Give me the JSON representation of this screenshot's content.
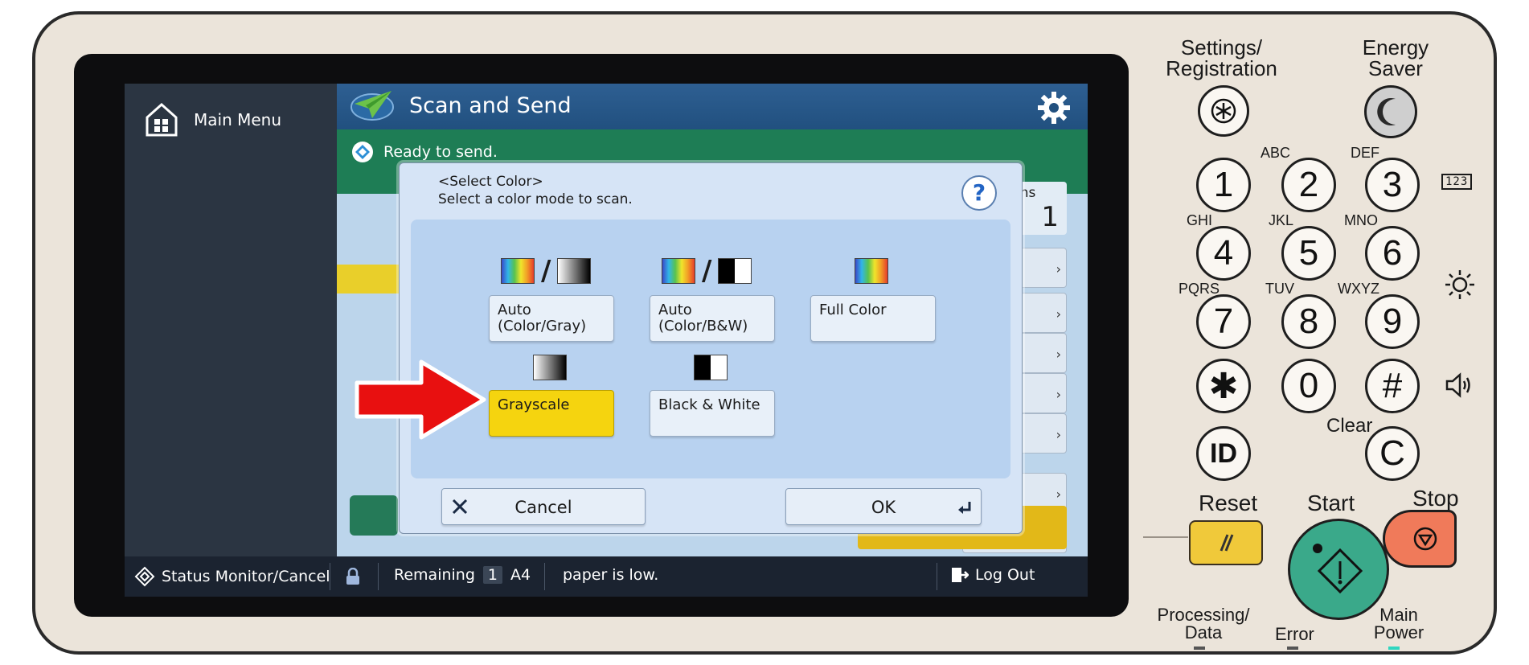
{
  "sidebar": {
    "main_menu_label": "Main Menu"
  },
  "app": {
    "title": "Scan and Send",
    "status": "Ready to send."
  },
  "destinations": {
    "label": "Destinations",
    "count": "1"
  },
  "dialog": {
    "title_line1": "<Select Color>",
    "title_line2": "Select a color mode to scan.",
    "options": [
      {
        "label_line1": "Auto",
        "label_line2": "(Color/Gray)"
      },
      {
        "label_line1": "Auto",
        "label_line2": "(Color/B&W)"
      },
      {
        "label_line1": "Full Color",
        "label_line2": ""
      },
      {
        "label_line1": "Grayscale",
        "label_line2": ""
      },
      {
        "label_line1": "Black & White",
        "label_line2": ""
      }
    ],
    "selected": "Grayscale",
    "cancel_label": "Cancel",
    "ok_label": "OK"
  },
  "statusbar": {
    "status_monitor_label": "Status Monitor/Cancel",
    "remaining_label": "Remaining",
    "remaining_count": "1",
    "paper_size": "A4",
    "paper_message": "paper is low.",
    "logout_label": "Log Out"
  },
  "hardware": {
    "settings_label_line1": "Settings/",
    "settings_label_line2": "Registration",
    "energy_label_line1": "Energy",
    "energy_label_line2": "Saver",
    "keys": [
      "1",
      "2",
      "3",
      "4",
      "5",
      "6",
      "7",
      "8",
      "9",
      "✱",
      "0",
      "#"
    ],
    "key_letters": {
      "2": "ABC",
      "3": "DEF",
      "4": "GHI",
      "5": "JKL",
      "6": "MNO",
      "7": "PQRS",
      "8": "TUV",
      "9": "WXYZ"
    },
    "numeric_badge": "123",
    "clear_label": "Clear",
    "clear_key": "C",
    "id_key": "ID",
    "reset_label": "Reset",
    "start_label": "Start",
    "stop_label": "Stop",
    "processing_label_line1": "Processing/",
    "processing_label_line2": "Data",
    "error_label": "Error",
    "main_power_label_line1": "Main",
    "main_power_label_line2": "Power"
  },
  "colors": {
    "accent_blue": "#21507f",
    "ready_green": "#1e7d55",
    "selected_yellow": "#f5d40f",
    "arrow_red": "#e81010",
    "start_green": "#3aa98a",
    "stop_orange": "#f07a5a",
    "reset_yellow": "#f0c93a"
  }
}
